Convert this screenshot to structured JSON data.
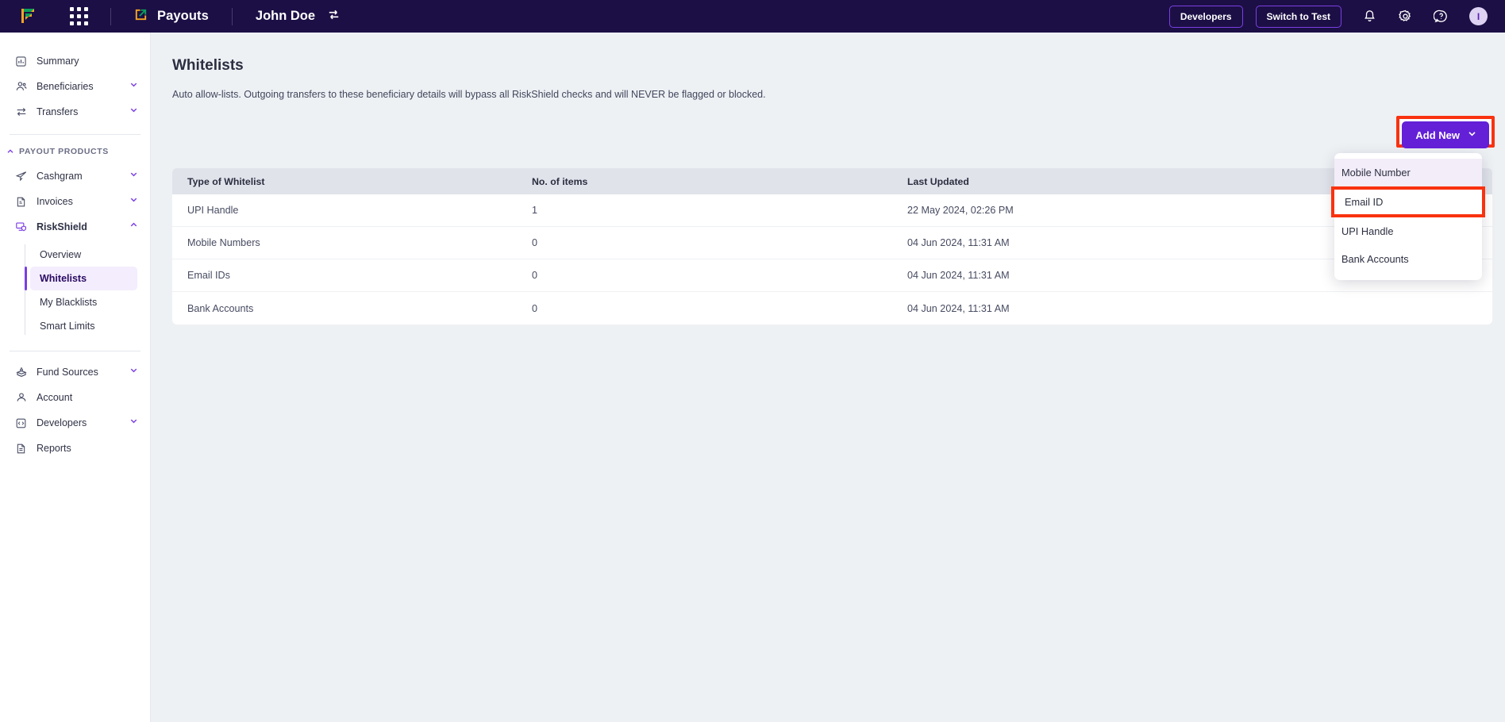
{
  "topbar": {
    "logo_icon": "cashfree-logo-icon",
    "apps_icon": "apps-grid-icon",
    "product_icon": "payouts-launch-icon",
    "product_label": "Payouts",
    "user_name": "John Doe",
    "switch_icon": "switch-account-icon",
    "developers_label": "Developers",
    "switch_to_test_label": "Switch to Test",
    "bell_icon": "notification-bell-icon",
    "gear_icon": "settings-gear-icon",
    "help_icon": "help-question-icon",
    "avatar_initial": "I"
  },
  "sidebar": {
    "items": [
      {
        "label": "Summary",
        "icon": "chart-bar-icon",
        "chevron": ""
      },
      {
        "label": "Beneficiaries",
        "icon": "users-icon",
        "chevron": "down"
      },
      {
        "label": "Transfers",
        "icon": "transfer-arrows-icon",
        "chevron": "down"
      }
    ],
    "section_title": "PAYOUT PRODUCTS",
    "section_chevron": "up",
    "products": [
      {
        "label": "Cashgram",
        "icon": "paper-plane-icon",
        "chevron": "down"
      },
      {
        "label": "Invoices",
        "icon": "invoice-document-icon",
        "chevron": "down"
      },
      {
        "label": "RiskShield",
        "icon": "riskshield-monitor-icon",
        "chevron": "up"
      }
    ],
    "riskshield_sub": [
      {
        "label": "Overview",
        "active": false
      },
      {
        "label": "Whitelists",
        "active": true
      },
      {
        "label": "My Blacklists",
        "active": false
      },
      {
        "label": "Smart Limits",
        "active": false
      }
    ],
    "bottom": [
      {
        "label": "Fund Sources",
        "icon": "fund-source-icon",
        "chevron": "down"
      },
      {
        "label": "Account",
        "icon": "person-icon",
        "chevron": ""
      },
      {
        "label": "Developers",
        "icon": "code-brackets-icon",
        "chevron": "down"
      },
      {
        "label": "Reports",
        "icon": "report-document-icon",
        "chevron": ""
      }
    ]
  },
  "page": {
    "title": "Whitelists",
    "description": "Auto allow-lists. Outgoing transfers to these beneficiary details will bypass all RiskShield checks and will NEVER be flagged or blocked.",
    "add_new_label": "Add New",
    "add_new_chevron": "chevron-down-icon"
  },
  "dropdown": {
    "items": [
      {
        "label": "Mobile Number",
        "state": "hover"
      },
      {
        "label": "Email ID",
        "state": "highlighted"
      },
      {
        "label": "UPI Handle",
        "state": "normal"
      },
      {
        "label": "Bank Accounts",
        "state": "normal"
      }
    ]
  },
  "table": {
    "headers": [
      "Type of Whitelist",
      "No. of items",
      "Last Updated"
    ],
    "rows": [
      {
        "type": "UPI Handle",
        "count": "1",
        "updated": "22 May 2024, 02:26 PM"
      },
      {
        "type": "Mobile Numbers",
        "count": "0",
        "updated": "04 Jun 2024, 11:31 AM"
      },
      {
        "type": "Email IDs",
        "count": "0",
        "updated": "04 Jun 2024, 11:31 AM"
      },
      {
        "type": "Bank Accounts",
        "count": "0",
        "updated": "04 Jun 2024, 11:31 AM"
      }
    ]
  },
  "colors": {
    "topbar_bg": "#1c0f45",
    "accent_purple": "#6320d7",
    "highlight_red": "#f9320f",
    "page_bg": "#eef1f4",
    "active_nav_bg": "#f3edfd"
  }
}
